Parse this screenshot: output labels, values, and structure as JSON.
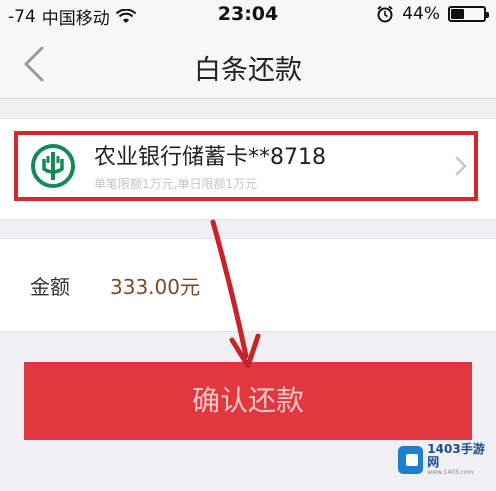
{
  "status_bar": {
    "signal": "-74",
    "carrier": "中国移动",
    "time": "23:04",
    "battery": "44%",
    "battery_level": 0.44
  },
  "nav": {
    "back_icon": "chevron-left-icon",
    "title": "白条还款"
  },
  "card": {
    "bank_icon": "abc-bank-logo-icon",
    "name": "农业银行储蓄卡**8718",
    "limit": "单笔限额1万元,单日限额1万元"
  },
  "amount": {
    "label": "金额",
    "value": "333.00元"
  },
  "confirm": {
    "label": "确认还款"
  },
  "watermark": {
    "text": "1403手游网",
    "url": "www.1403.com"
  },
  "colors": {
    "accent_red": "#e0383e",
    "highlight_red": "#d9262d",
    "bank_green": "#138a57",
    "watermark_blue": "#1e7fd1"
  }
}
